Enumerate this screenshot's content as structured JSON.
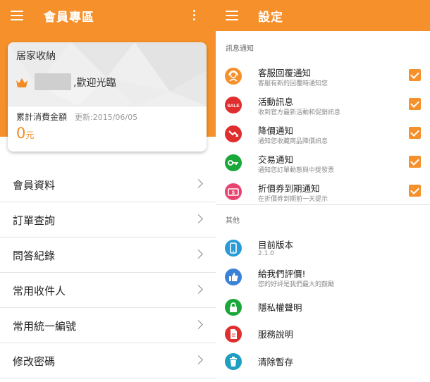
{
  "left": {
    "appbar_title": "會員專區",
    "card": {
      "title": "居家收納",
      "welcome": ",歡迎光臨",
      "spend_label": "累計消費金額",
      "updated": "更新:2015/06/05",
      "amount": "0",
      "amount_unit": "元"
    },
    "menu": [
      {
        "label": "會員資料"
      },
      {
        "label": "訂單查詢"
      },
      {
        "label": "問答紀錄"
      },
      {
        "label": "常用收件人"
      },
      {
        "label": "常用統一編號"
      },
      {
        "label": "修改密碼"
      }
    ]
  },
  "right": {
    "appbar_title": "設定",
    "notifications_header": "訊息通知",
    "notifications": [
      {
        "title": "客服回覆通知",
        "subtitle": "客服有新的回覆時通知您",
        "icon": "customer-service-icon",
        "color": "#f5902a",
        "checked": true
      },
      {
        "title": "活動訊息",
        "subtitle": "收到官方最新活動和促銷訊息",
        "icon": "sale-tag-icon",
        "icon_text": "SALE",
        "color": "#e02e2e",
        "checked": true
      },
      {
        "title": "降價通知",
        "subtitle": "通知您收藏商品降價訊息",
        "icon": "price-drop-icon",
        "color": "#e02e2e",
        "checked": true
      },
      {
        "title": "交易通知",
        "subtitle": "通知您訂單動態與中獎發票",
        "icon": "key-icon",
        "color": "#1aa83a",
        "checked": true
      },
      {
        "title": "折價券到期通知",
        "subtitle": "在折價券到期前一天提示",
        "icon": "coupon-icon",
        "color": "#e8436f",
        "checked": true
      }
    ],
    "other_header": "其他",
    "others": [
      {
        "title": "目前版本",
        "subtitle": "2.1.0",
        "icon": "phone-icon",
        "color": "#2a9bd6"
      },
      {
        "title": "給我們評價!",
        "subtitle": "您的好評是我們最大的鼓勵",
        "icon": "thumbs-up-icon",
        "color": "#3b82d6"
      },
      {
        "title": "隱私權聲明",
        "subtitle": "",
        "icon": "lock-icon",
        "color": "#1aa83a"
      },
      {
        "title": "服務說明",
        "subtitle": "",
        "icon": "document-icon",
        "color": "#e02e2e"
      },
      {
        "title": "清除暫存",
        "subtitle": "",
        "icon": "trash-icon",
        "color": "#1e9fbf"
      }
    ]
  }
}
